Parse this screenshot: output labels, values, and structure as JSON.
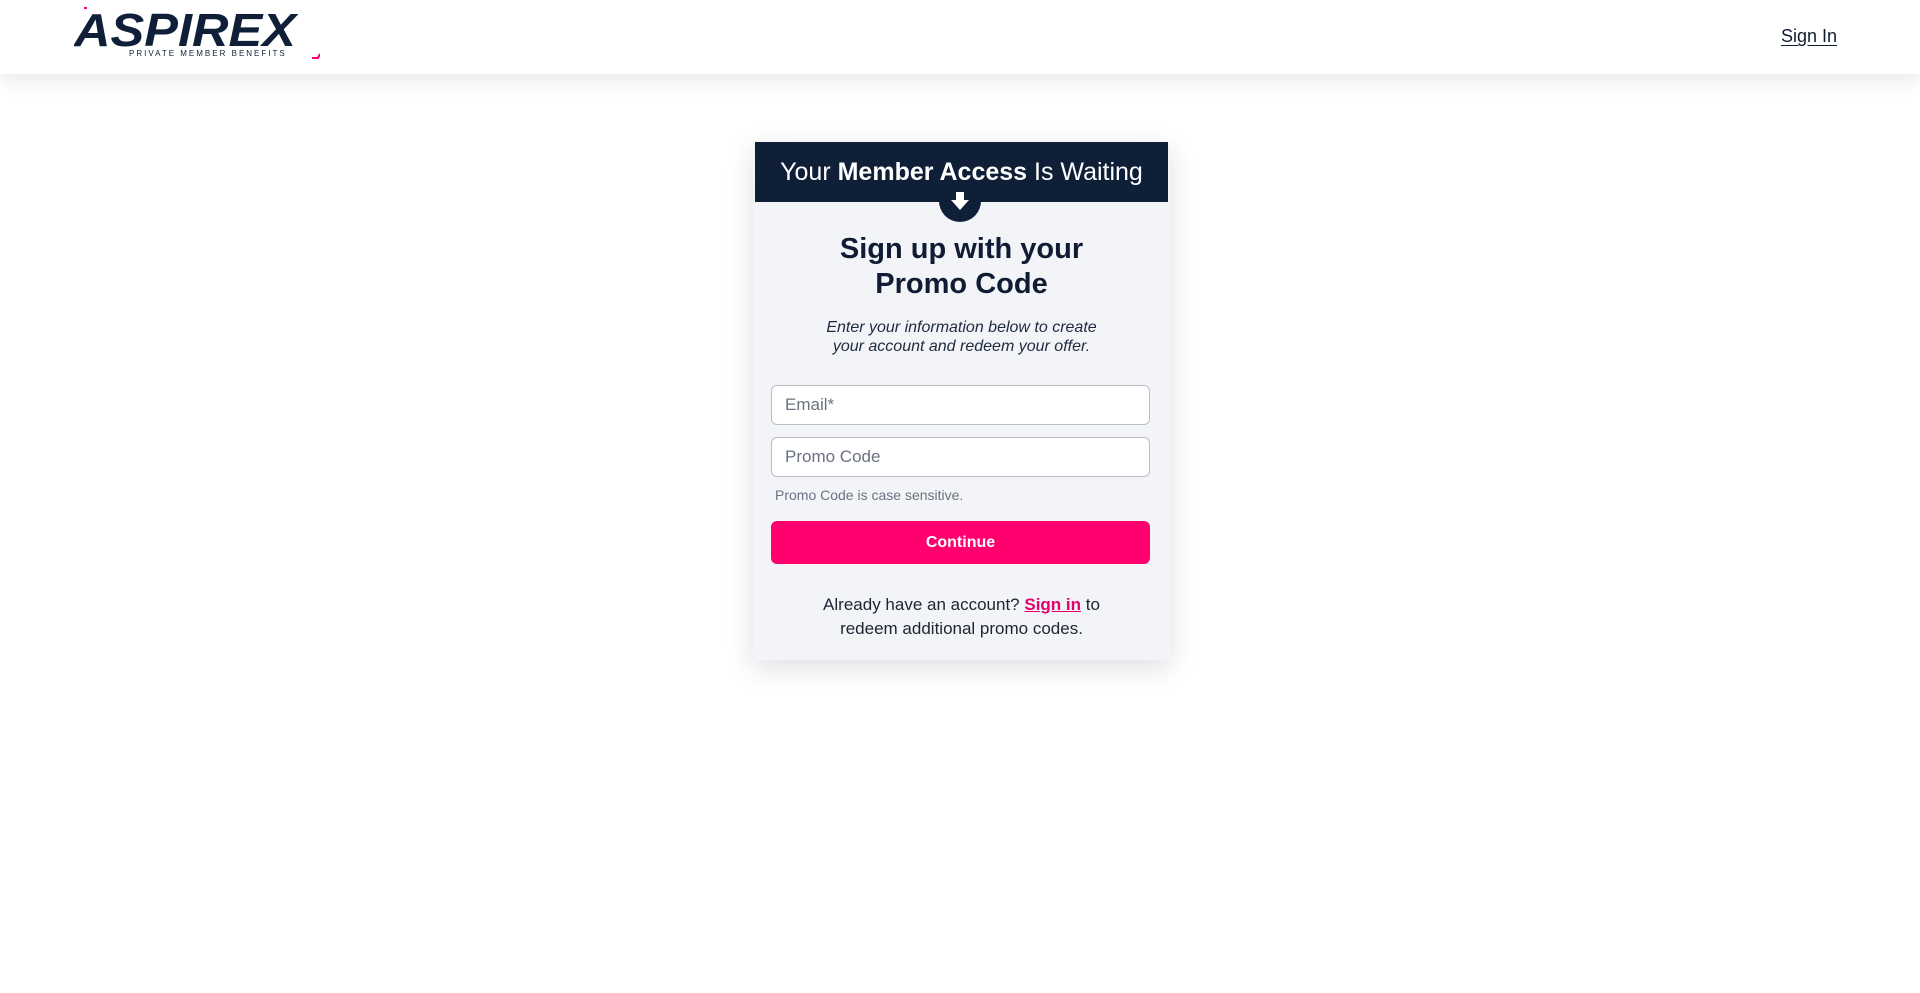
{
  "header": {
    "brand": "ASPIREX",
    "tagline": "PRIVATE MEMBER BENEFITS",
    "signin_label": "Sign In"
  },
  "card": {
    "banner": {
      "prefix": "Your ",
      "bold": "Member Access",
      "suffix": " Is Waiting"
    },
    "arrow_icon": "arrow-down-icon",
    "title_line1": "Sign up with your",
    "title_line2": "Promo Code",
    "subtitle_line1": "Enter your information below to create",
    "subtitle_line2": "your account and redeem your offer.",
    "email": {
      "placeholder": "Email*",
      "value": ""
    },
    "promo": {
      "placeholder": "Promo Code",
      "value": ""
    },
    "helper": "Promo Code is case sensitive.",
    "continue_label": "Continue",
    "footer": {
      "before": "Already have an account? ",
      "link": "Sign in",
      "after": " to",
      "line2": "redeem additional promo codes."
    }
  },
  "colors": {
    "navy": "#0f1f38",
    "accent": "#ff006e",
    "card_bg": "#f3f4f8"
  }
}
